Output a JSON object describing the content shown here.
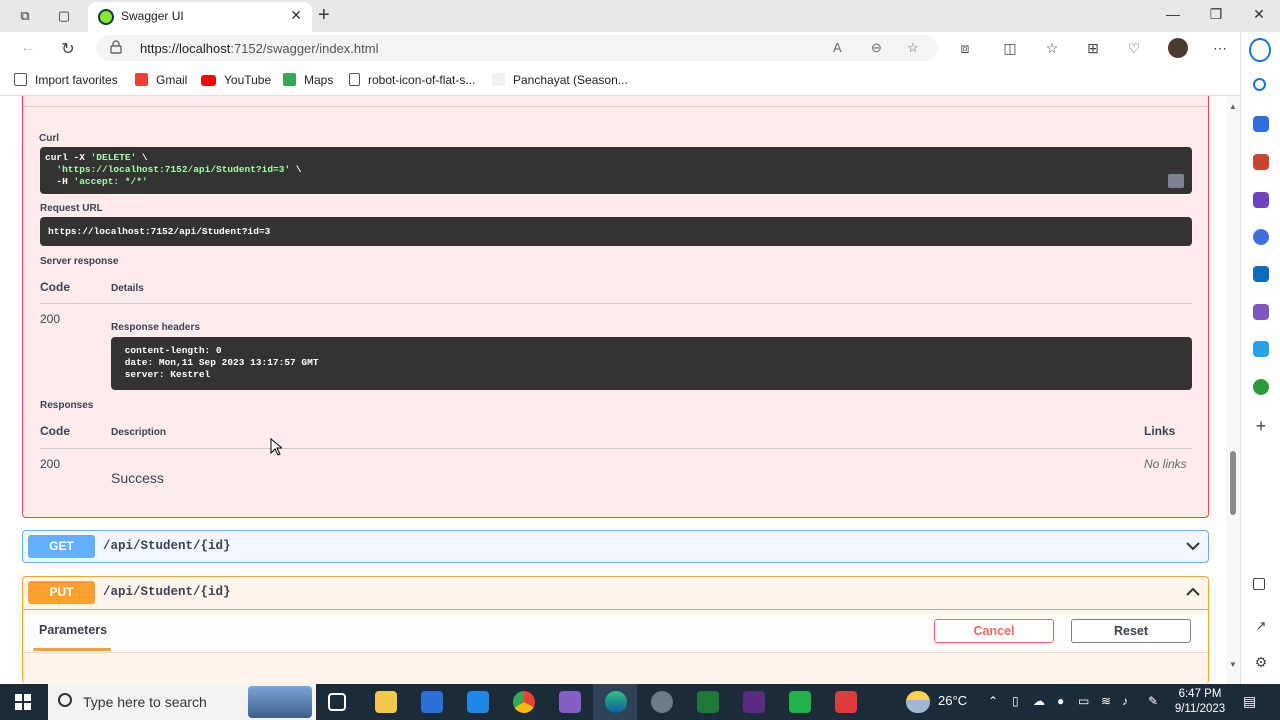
{
  "browser": {
    "tab_title": "Swagger UI",
    "url_host": "https://localhost",
    "url_rest": ":7152/swagger/index.html",
    "bookmarks": [
      "Import favorites",
      "Gmail",
      "YouTube",
      "Maps",
      "robot-icon-of-flat-s...",
      "Panchayat (Season..."
    ]
  },
  "delete_block": {
    "curl_label": "Curl",
    "curl_line1_cmd": "curl -X ",
    "curl_line1_str": "'DELETE'",
    "curl_line1_end": " \\",
    "curl_line2_str": "  'https://localhost:7152/api/Student?id=3'",
    "curl_line2_end": " \\",
    "curl_line3_cmd": "  -H ",
    "curl_line3_str": "'accept: */*'",
    "request_url_label": "Request URL",
    "request_url": "https://localhost:7152/api/Student?id=3",
    "server_response_label": "Server response",
    "code_header": "Code",
    "details_header": "Details",
    "response_code": "200",
    "response_headers_label": "Response headers",
    "response_headers": [
      " content-length: 0 ",
      " date: Mon,11 Sep 2023 13:17:57 GMT ",
      " server: Kestrel "
    ],
    "responses_label": "Responses",
    "responses_code_header": "Code",
    "responses_description_header": "Description",
    "responses_links_header": "Links",
    "responses_row_code": "200",
    "responses_row_description": "Success",
    "responses_row_links": "No links"
  },
  "get_block": {
    "method": "GET",
    "path": "/api/Student/{id}"
  },
  "put_block": {
    "method": "PUT",
    "path": "/api/Student/{id}",
    "params_tab": "Parameters",
    "cancel_label": "Cancel",
    "reset_label": "Reset"
  },
  "taskbar": {
    "search_placeholder": "Type here to search",
    "temperature": "26°C",
    "time": "6:47 PM",
    "date": "9/11/2023"
  },
  "colors": {
    "delete": "#f93e3e",
    "get": "#61affe",
    "put": "#fca130"
  }
}
